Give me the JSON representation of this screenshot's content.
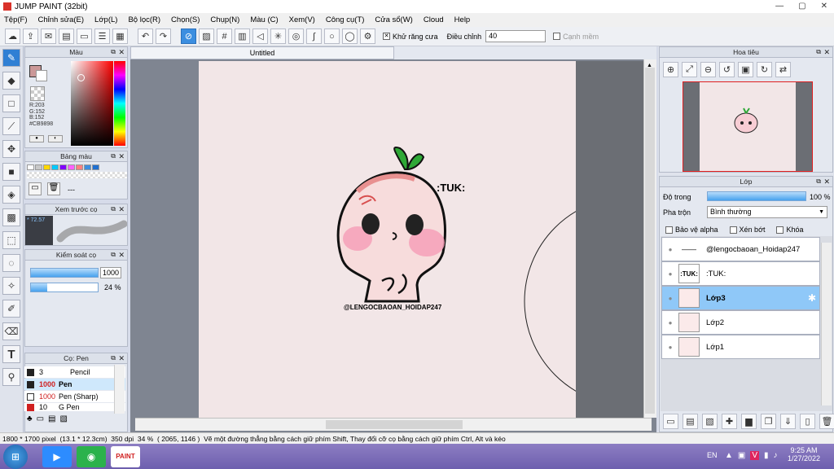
{
  "window": {
    "title": "JUMP PAINT (32bit)"
  },
  "menu": [
    "Tệp(F)",
    "Chỉnh sửa(E)",
    "Lớp(L)",
    "Bộ lọc(R)",
    "Chọn(S)",
    "Chụp(N)",
    "Màu (C)",
    "Xem(V)",
    "Công cụ(T)",
    "Cửa sổ(W)",
    "Cloud",
    "Help"
  ],
  "toolbar": {
    "antialias_label": "Khử răng cưa",
    "adjust_label": "Điều chỉnh",
    "adjust_value": "40",
    "edge_label": "Cạnh mềm"
  },
  "color_panel": {
    "title": "Màu",
    "r": "R:203",
    "g": "G:152",
    "b": "B:152",
    "hex": "#CB9898",
    "current": "#CB9898"
  },
  "palette_panel": {
    "title": "Bảng màu",
    "swatches": [
      "#ffffff",
      "#c8c8c8",
      "#ffd700",
      "#00c8ff",
      "#8000ff",
      "#ff60ff",
      "#ff8080",
      "#3c8ee0",
      "#2070d0"
    ],
    "more_label": "---"
  },
  "preview_panel": {
    "title": "Xem trước cọ",
    "value": "* 72.57"
  },
  "brush_control": {
    "title": "Kiểm soát cọ",
    "size": "1000",
    "opacity": "24 %",
    "opacity_value": 24,
    "size_fill": 100
  },
  "brush_list": {
    "title": "Cọ: Pen",
    "items": [
      {
        "size": "3",
        "name": "Pencil"
      },
      {
        "size": "1000",
        "name": "Pen"
      },
      {
        "size": "1000",
        "name": "Pen (Sharp)"
      },
      {
        "size": "10",
        "name": "G Pen"
      }
    ]
  },
  "document_tab": "Untitled",
  "artwork": {
    "tag_text": ":TUK:",
    "signature": "@LENGOCBAOAN_HOIDAP247"
  },
  "navigator": {
    "title": "Hoa tiêu"
  },
  "layers_panel": {
    "title": "Lớp",
    "opacity_label": "Độ trong",
    "opacity_value": "100 %",
    "blend_label": "Pha trộn",
    "blend_value": "Bình thường",
    "protect_alpha": "Bảo vệ alpha",
    "clip": "Xén bớt",
    "lock": "Khóa",
    "layers": [
      {
        "name": "@lengocbaoan_Hoidap247",
        "thumb": "——"
      },
      {
        "name": ":TUK:",
        "thumb": ":TUK:"
      },
      {
        "name": "Lớp3",
        "thumb": ""
      },
      {
        "name": "Lớp2",
        "thumb": ""
      },
      {
        "name": "Lớp1",
        "thumb": ""
      }
    ]
  },
  "status": {
    "size": "1800 * 1700 pixel",
    "cm": "(13.1 * 12.3cm)",
    "dpi": "350 dpi",
    "zoom": "34 %",
    "coords": "( 2065, 1146 )",
    "hint": "Vẽ một đường thẳng bằng cách giữ phím Shift, Thay đổi cỡ cọ bằng cách giữ phím Ctrl, Alt và kéo"
  },
  "taskbar": {
    "lang": "EN",
    "time": "9:25 AM",
    "date": "1/27/2022"
  }
}
